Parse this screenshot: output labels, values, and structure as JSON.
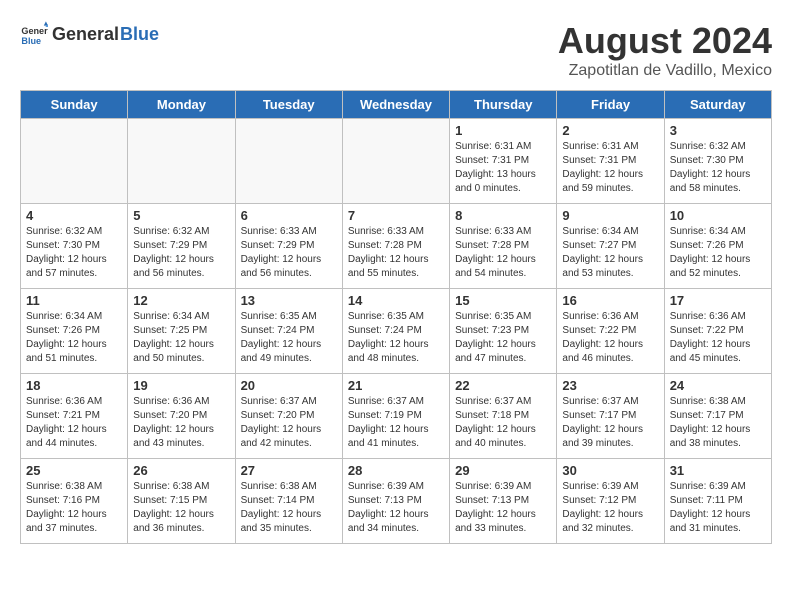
{
  "header": {
    "logo_general": "General",
    "logo_blue": "Blue",
    "month_year": "August 2024",
    "location": "Zapotitlan de Vadillo, Mexico"
  },
  "days_of_week": [
    "Sunday",
    "Monday",
    "Tuesday",
    "Wednesday",
    "Thursday",
    "Friday",
    "Saturday"
  ],
  "weeks": [
    [
      {
        "day": "",
        "info": ""
      },
      {
        "day": "",
        "info": ""
      },
      {
        "day": "",
        "info": ""
      },
      {
        "day": "",
        "info": ""
      },
      {
        "day": "1",
        "info": "Sunrise: 6:31 AM\nSunset: 7:31 PM\nDaylight: 13 hours\nand 0 minutes."
      },
      {
        "day": "2",
        "info": "Sunrise: 6:31 AM\nSunset: 7:31 PM\nDaylight: 12 hours\nand 59 minutes."
      },
      {
        "day": "3",
        "info": "Sunrise: 6:32 AM\nSunset: 7:30 PM\nDaylight: 12 hours\nand 58 minutes."
      }
    ],
    [
      {
        "day": "4",
        "info": "Sunrise: 6:32 AM\nSunset: 7:30 PM\nDaylight: 12 hours\nand 57 minutes."
      },
      {
        "day": "5",
        "info": "Sunrise: 6:32 AM\nSunset: 7:29 PM\nDaylight: 12 hours\nand 56 minutes."
      },
      {
        "day": "6",
        "info": "Sunrise: 6:33 AM\nSunset: 7:29 PM\nDaylight: 12 hours\nand 56 minutes."
      },
      {
        "day": "7",
        "info": "Sunrise: 6:33 AM\nSunset: 7:28 PM\nDaylight: 12 hours\nand 55 minutes."
      },
      {
        "day": "8",
        "info": "Sunrise: 6:33 AM\nSunset: 7:28 PM\nDaylight: 12 hours\nand 54 minutes."
      },
      {
        "day": "9",
        "info": "Sunrise: 6:34 AM\nSunset: 7:27 PM\nDaylight: 12 hours\nand 53 minutes."
      },
      {
        "day": "10",
        "info": "Sunrise: 6:34 AM\nSunset: 7:26 PM\nDaylight: 12 hours\nand 52 minutes."
      }
    ],
    [
      {
        "day": "11",
        "info": "Sunrise: 6:34 AM\nSunset: 7:26 PM\nDaylight: 12 hours\nand 51 minutes."
      },
      {
        "day": "12",
        "info": "Sunrise: 6:34 AM\nSunset: 7:25 PM\nDaylight: 12 hours\nand 50 minutes."
      },
      {
        "day": "13",
        "info": "Sunrise: 6:35 AM\nSunset: 7:24 PM\nDaylight: 12 hours\nand 49 minutes."
      },
      {
        "day": "14",
        "info": "Sunrise: 6:35 AM\nSunset: 7:24 PM\nDaylight: 12 hours\nand 48 minutes."
      },
      {
        "day": "15",
        "info": "Sunrise: 6:35 AM\nSunset: 7:23 PM\nDaylight: 12 hours\nand 47 minutes."
      },
      {
        "day": "16",
        "info": "Sunrise: 6:36 AM\nSunset: 7:22 PM\nDaylight: 12 hours\nand 46 minutes."
      },
      {
        "day": "17",
        "info": "Sunrise: 6:36 AM\nSunset: 7:22 PM\nDaylight: 12 hours\nand 45 minutes."
      }
    ],
    [
      {
        "day": "18",
        "info": "Sunrise: 6:36 AM\nSunset: 7:21 PM\nDaylight: 12 hours\nand 44 minutes."
      },
      {
        "day": "19",
        "info": "Sunrise: 6:36 AM\nSunset: 7:20 PM\nDaylight: 12 hours\nand 43 minutes."
      },
      {
        "day": "20",
        "info": "Sunrise: 6:37 AM\nSunset: 7:20 PM\nDaylight: 12 hours\nand 42 minutes."
      },
      {
        "day": "21",
        "info": "Sunrise: 6:37 AM\nSunset: 7:19 PM\nDaylight: 12 hours\nand 41 minutes."
      },
      {
        "day": "22",
        "info": "Sunrise: 6:37 AM\nSunset: 7:18 PM\nDaylight: 12 hours\nand 40 minutes."
      },
      {
        "day": "23",
        "info": "Sunrise: 6:37 AM\nSunset: 7:17 PM\nDaylight: 12 hours\nand 39 minutes."
      },
      {
        "day": "24",
        "info": "Sunrise: 6:38 AM\nSunset: 7:17 PM\nDaylight: 12 hours\nand 38 minutes."
      }
    ],
    [
      {
        "day": "25",
        "info": "Sunrise: 6:38 AM\nSunset: 7:16 PM\nDaylight: 12 hours\nand 37 minutes."
      },
      {
        "day": "26",
        "info": "Sunrise: 6:38 AM\nSunset: 7:15 PM\nDaylight: 12 hours\nand 36 minutes."
      },
      {
        "day": "27",
        "info": "Sunrise: 6:38 AM\nSunset: 7:14 PM\nDaylight: 12 hours\nand 35 minutes."
      },
      {
        "day": "28",
        "info": "Sunrise: 6:39 AM\nSunset: 7:13 PM\nDaylight: 12 hours\nand 34 minutes."
      },
      {
        "day": "29",
        "info": "Sunrise: 6:39 AM\nSunset: 7:13 PM\nDaylight: 12 hours\nand 33 minutes."
      },
      {
        "day": "30",
        "info": "Sunrise: 6:39 AM\nSunset: 7:12 PM\nDaylight: 12 hours\nand 32 minutes."
      },
      {
        "day": "31",
        "info": "Sunrise: 6:39 AM\nSunset: 7:11 PM\nDaylight: 12 hours\nand 31 minutes."
      }
    ]
  ]
}
